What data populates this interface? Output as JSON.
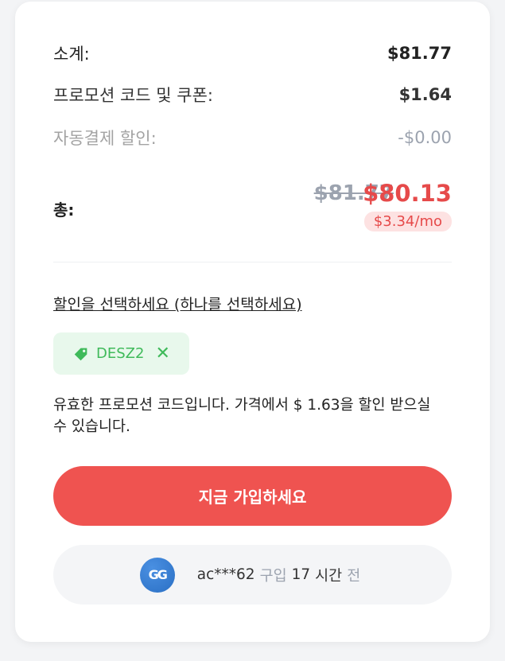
{
  "summary": {
    "subtotal_label": "소계:",
    "subtotal_value": "$81.77",
    "promo_label": "프로모션 코드 및 쿠폰:",
    "promo_value": "$1.64",
    "autopay_label": "자동결제 할인:",
    "autopay_value": "-$0.00",
    "total_label": "총:",
    "original_price": "$81.77",
    "final_price": "$80.13",
    "per_month": "$3.34/mo"
  },
  "discount": {
    "link_text": "할인을 선택하세요 (하나를 선택하세요)",
    "coupon_code": "DESZ2",
    "coupon_icon": "tag-icon",
    "remove_icon": "close-icon",
    "message": "유효한 프로모션 코드입니다. 가격에서 $ 1.63을 할인 받으실 수 있습니다."
  },
  "cta": {
    "label": "지금 가입하세요"
  },
  "activity": {
    "avatar_text": "GG",
    "user": "ac***62",
    "action": "구입",
    "time_amount": "17",
    "time_unit": "시간",
    "ago": "전"
  },
  "colors": {
    "accent": "#ef5350",
    "price_red": "#e64a4a",
    "coupon_green": "#3fba5a",
    "coupon_bg": "#e8f8ec"
  }
}
